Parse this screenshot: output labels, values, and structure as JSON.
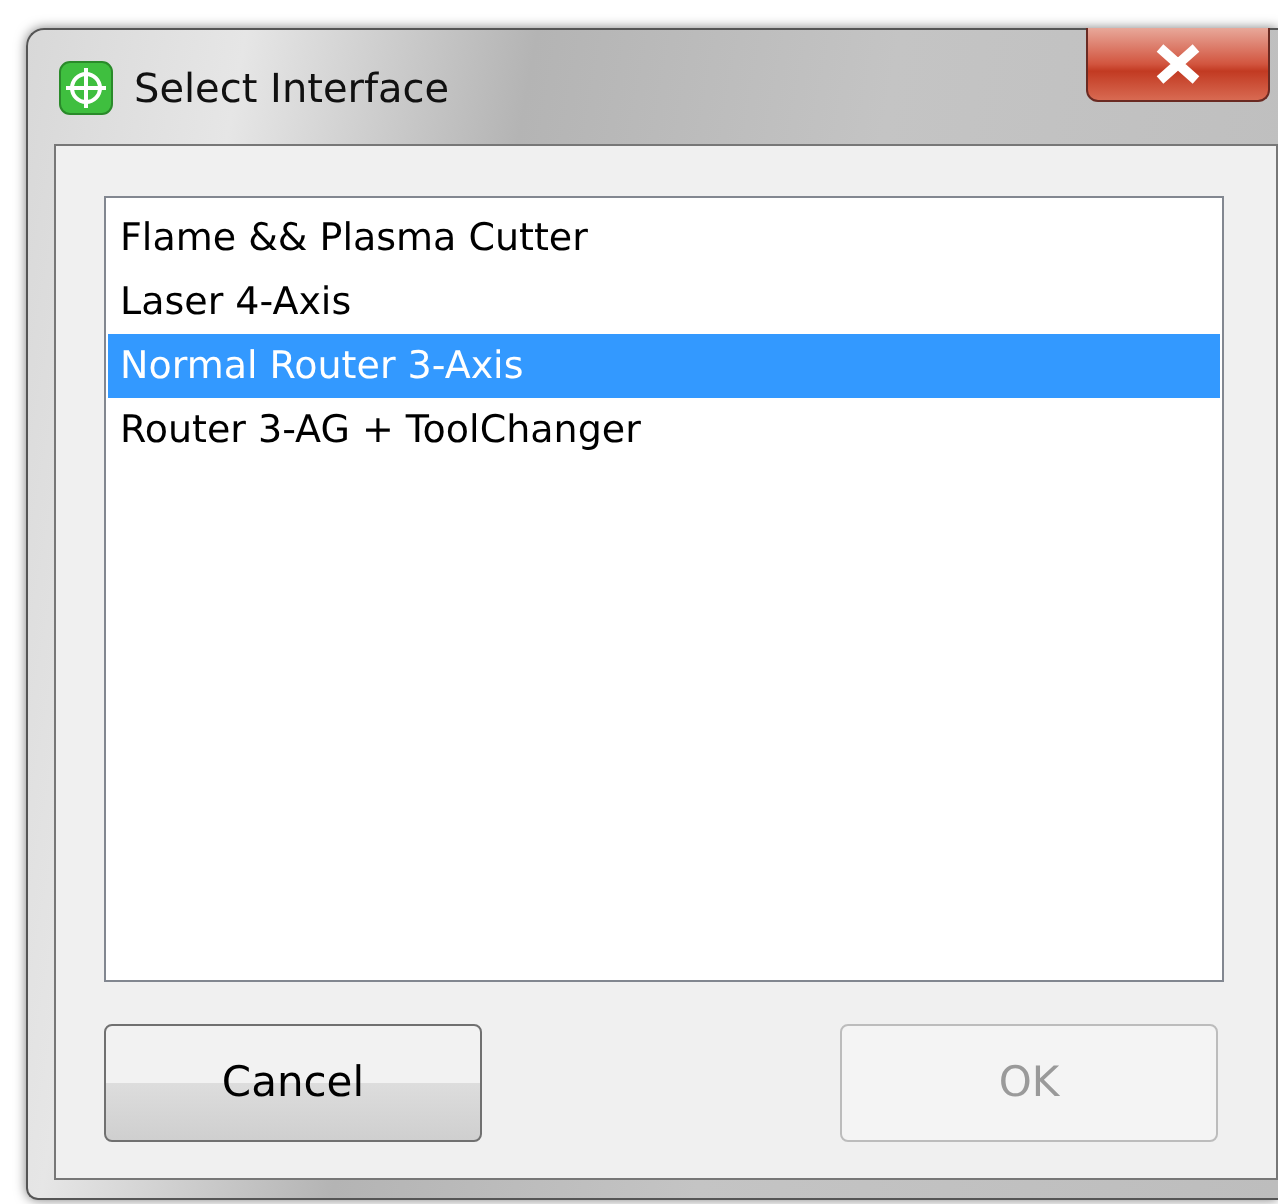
{
  "window": {
    "title": "Select Interface"
  },
  "list": {
    "items": [
      {
        "label": "Flame && Plasma Cutter",
        "selected": false
      },
      {
        "label": "Laser 4-Axis",
        "selected": false
      },
      {
        "label": "Normal Router 3-Axis",
        "selected": true
      },
      {
        "label": "Router 3-AG + ToolChanger",
        "selected": false
      }
    ]
  },
  "buttons": [
    {
      "label": "Cancel",
      "disabled": false
    },
    {
      "label": "OK",
      "disabled": true
    }
  ]
}
